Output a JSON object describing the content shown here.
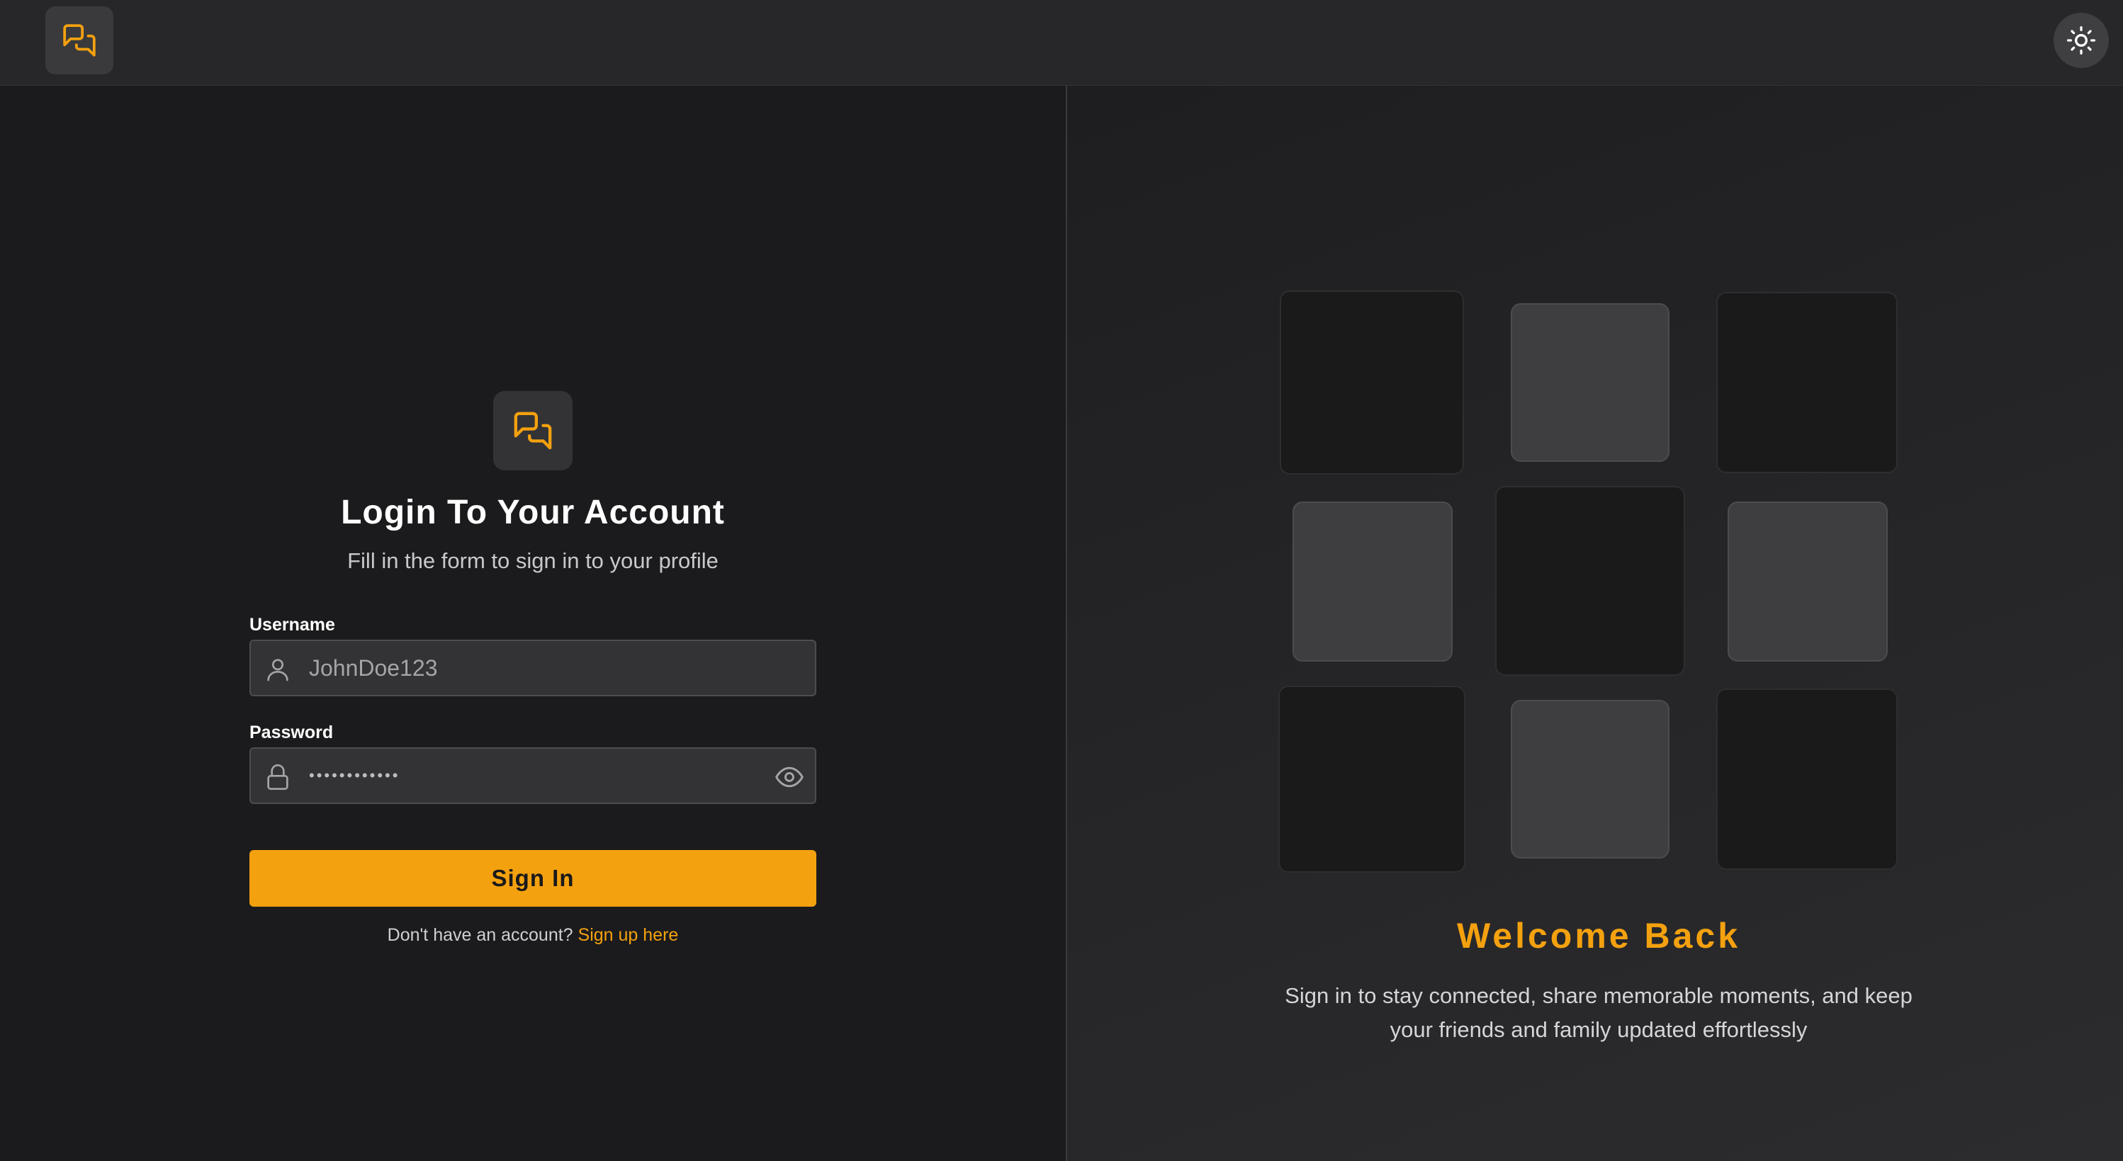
{
  "header": {
    "logo_icon": "chat-bubbles-icon",
    "theme_icon": "sun-icon"
  },
  "form": {
    "logo_icon": "chat-bubbles-icon",
    "title": "Login To Your Account",
    "subtitle": "Fill in the form to sign in to your profile",
    "username": {
      "label": "Username",
      "placeholder": "JohnDoe123",
      "icon": "user-icon"
    },
    "password": {
      "label": "Password",
      "value": "••••••••••••",
      "icon": "lock-icon",
      "toggle_icon": "eye-icon"
    },
    "submit_label": "Sign In",
    "signup_prompt": "Don't have an account?",
    "signup_link": "Sign up here"
  },
  "hero": {
    "tile_pattern": [
      "dark",
      "light",
      "dark",
      "light",
      "dark",
      "light",
      "dark",
      "light",
      "dark"
    ],
    "title": "Welcome Back",
    "text": "Sign in to stay connected, share memorable moments, and keep your friends and family updated effortlessly"
  },
  "colors": {
    "accent": "#f4a10f",
    "background": "#1b1b1d",
    "header": "#27272a"
  }
}
